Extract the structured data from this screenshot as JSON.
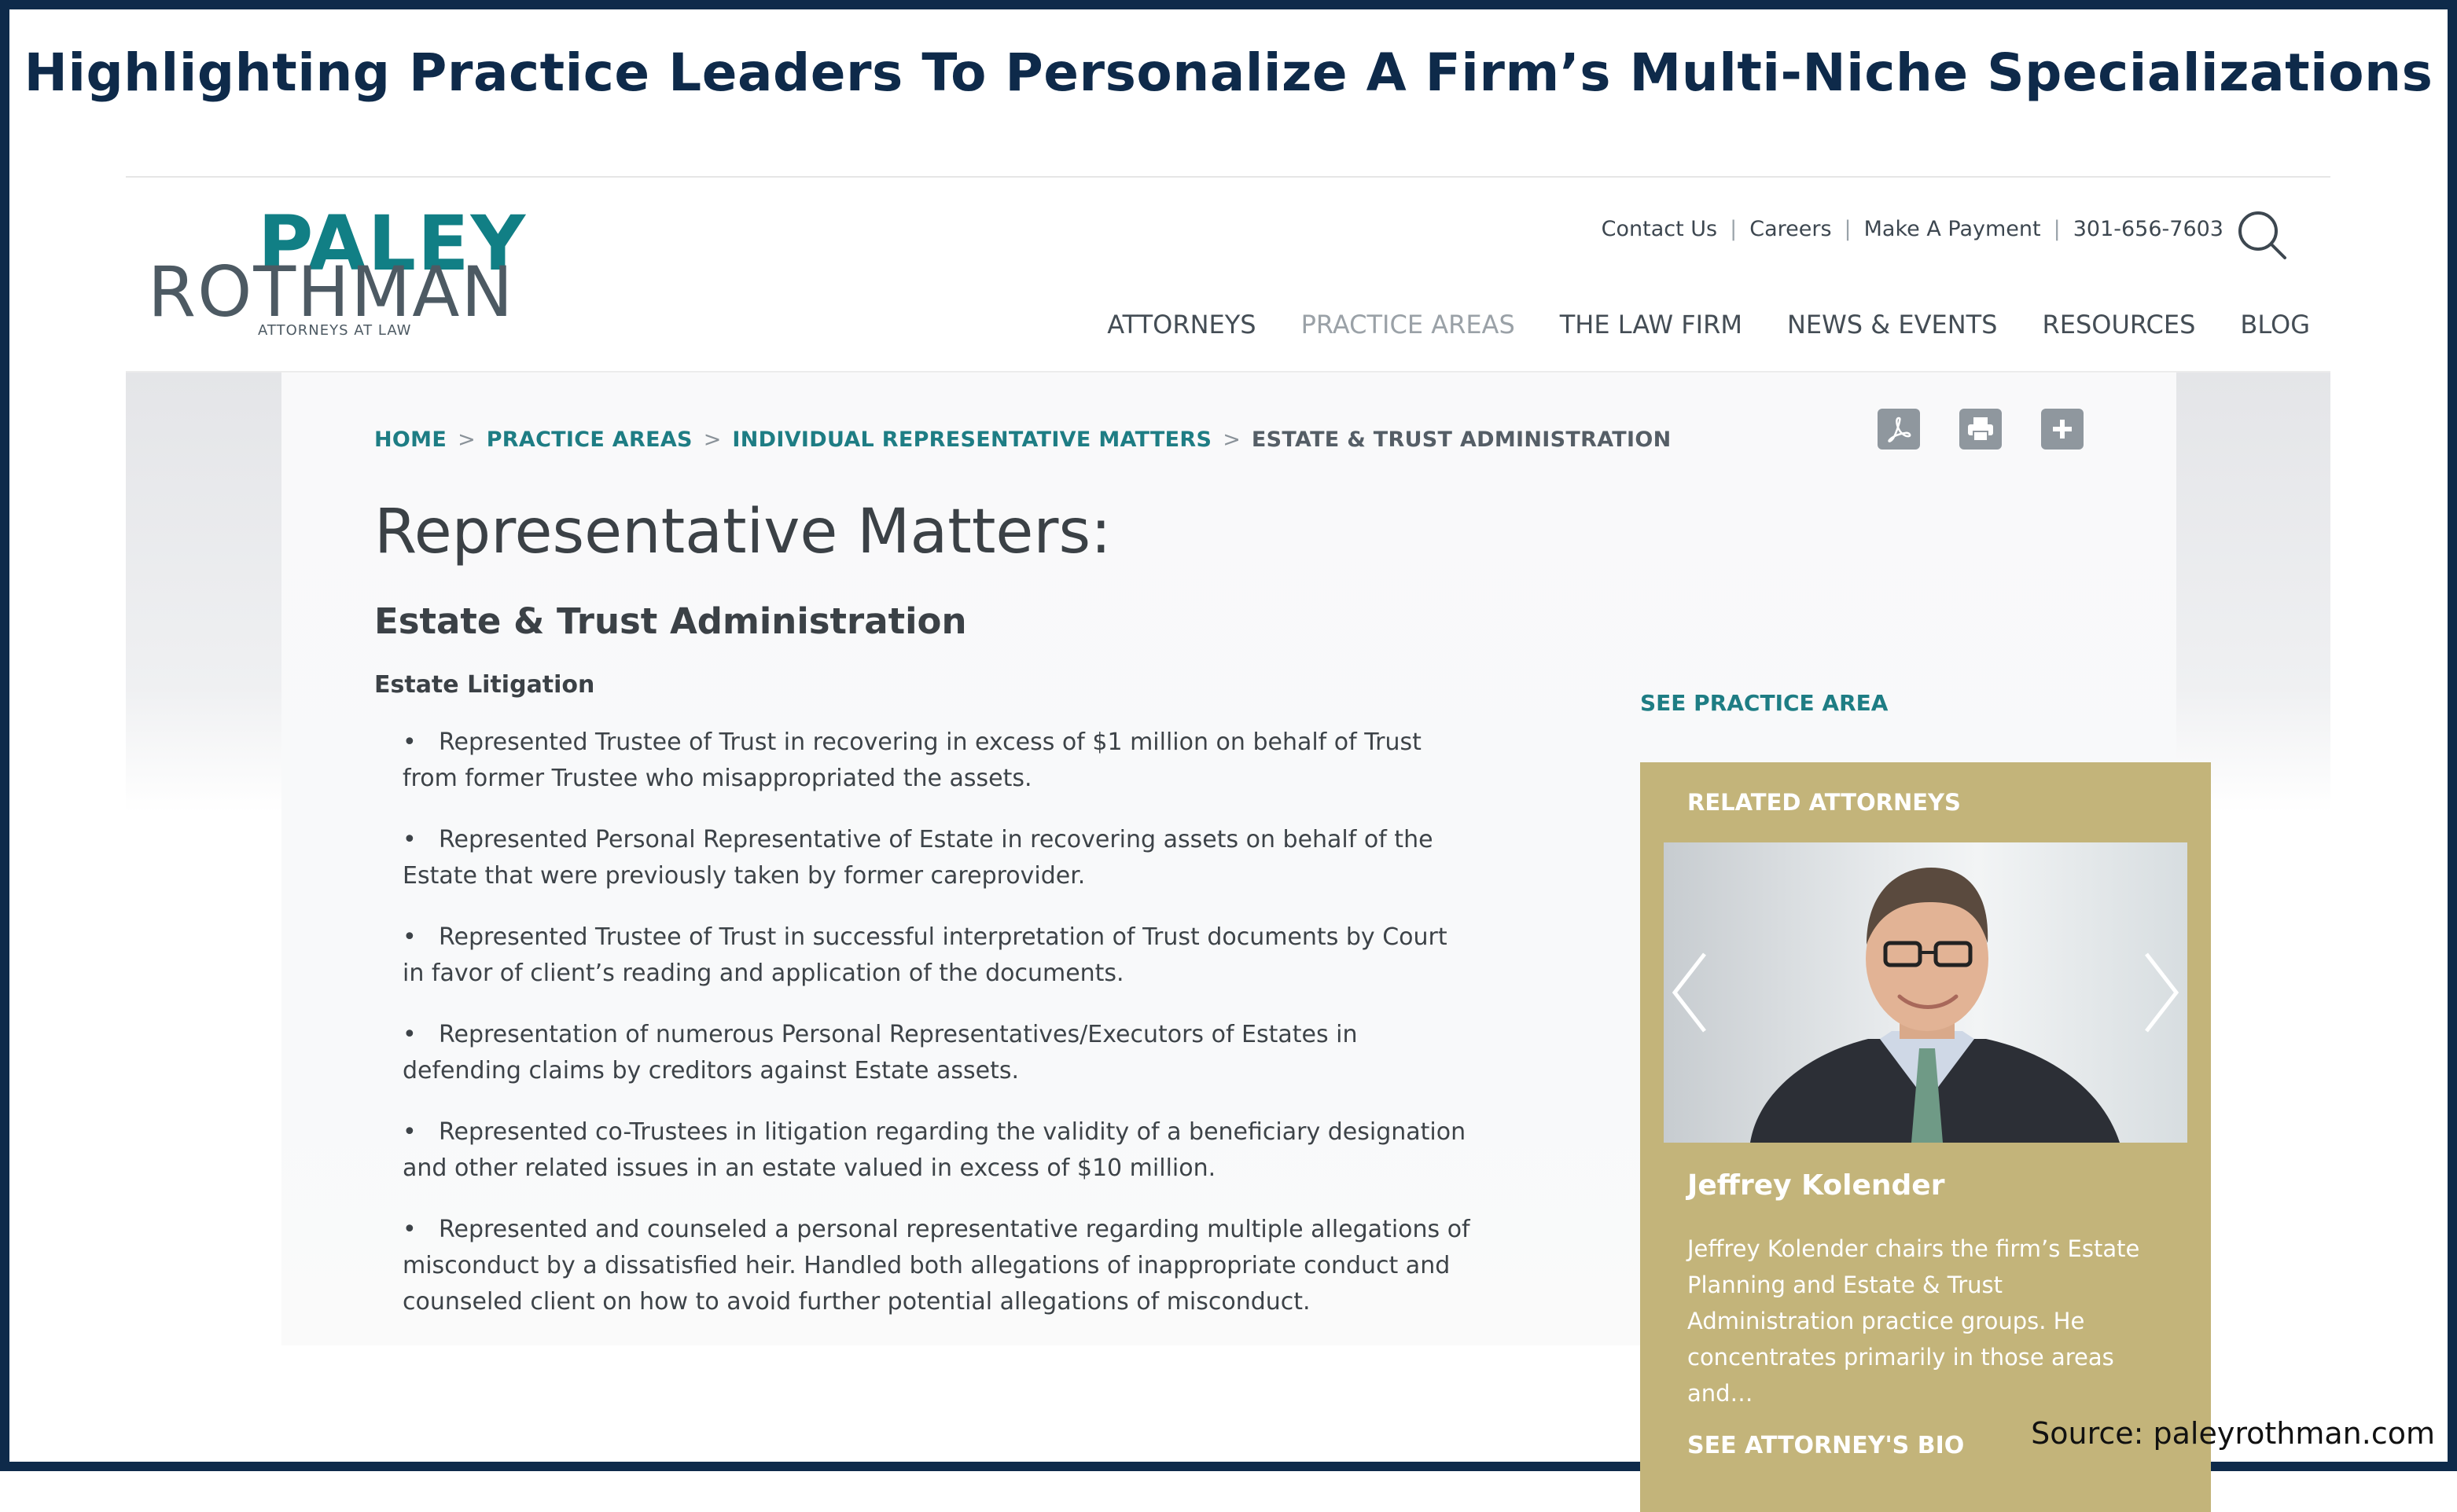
{
  "headline": "Highlighting Practice Leaders To Personalize A Firm’s Multi-Niche Specializations",
  "source": "Source: paleyrothman.com",
  "logo": {
    "line1": "PALEY",
    "line2": "ROTHMAN",
    "tagline": "ATTORNEYS AT LAW",
    "colors": {
      "paley": "#117f85",
      "rothman": "#4d5a63"
    }
  },
  "utility_nav": [
    "Contact Us",
    "Careers",
    "Make A Payment",
    "301-656-7603"
  ],
  "search_icon": "search-icon",
  "main_nav": [
    {
      "label": "ATTORNEYS",
      "active": false
    },
    {
      "label": "PRACTICE AREAS",
      "active": true
    },
    {
      "label": "THE LAW FIRM",
      "active": false
    },
    {
      "label": "NEWS & EVENTS",
      "active": false
    },
    {
      "label": "RESOURCES",
      "active": false
    },
    {
      "label": "BLOG",
      "active": false
    }
  ],
  "breadcrumb": [
    "HOME",
    "PRACTICE AREAS",
    "INDIVIDUAL REPRESENTATIVE MATTERS",
    "ESTATE & TRUST ADMINISTRATION"
  ],
  "tools": [
    "pdf-icon",
    "print-icon",
    "plus-icon"
  ],
  "page_title": "Representative Matters:",
  "subtitle": "Estate & Trust Administration",
  "section_label": "Estate Litigation",
  "bullets": [
    "Represented Trustee of Trust in recovering in excess of $1 million on behalf of Trust from former Trustee who misappropriated the assets.",
    "Represented Personal Representative of Estate in recovering assets on behalf of the Estate that were previously taken by former careprovider.",
    "Represented Trustee of Trust in successful interpretation of Trust documents by Court in favor of client’s reading and application of the documents.",
    "Representation of numerous Personal Representatives/Executors of Estates in defending claims by creditors against Estate assets.",
    "Represented co-Trustees in litigation regarding the validity of a beneficiary designation and other related issues in an estate valued in excess of $10 million.",
    "Represented and counseled a personal representative regarding multiple allegations of misconduct by a dissatisfied heir. Handled both allegations of inappropriate conduct and counseled client on how to avoid further potential allegations of misconduct."
  ],
  "sidebar": {
    "see_practice_area": "SEE PRACTICE AREA",
    "card_heading": "RELATED ATTORNEYS",
    "attorney_name": "Jeffrey Kolender",
    "attorney_desc": "Jeffrey Kolender chairs the firm’s Estate Planning and Estate & Trust Administration practice groups. He concentrates primarily in those areas and…",
    "bio_link": "SEE ATTORNEY'S BIO",
    "card_color": "#c3b47a"
  },
  "colors": {
    "frame": "#0e2a4a",
    "accent": "#1e7d84",
    "text": "#3b4146"
  }
}
